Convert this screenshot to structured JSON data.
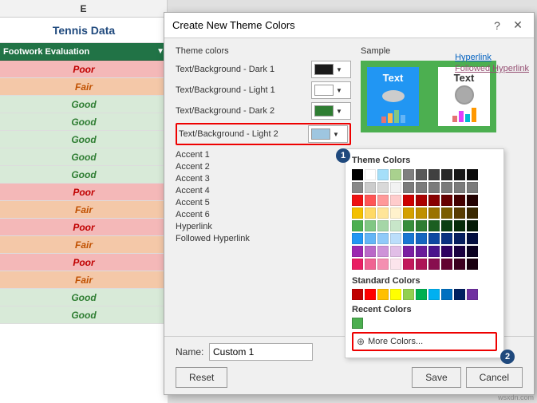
{
  "spreadsheet": {
    "col_header": "E",
    "title": "Tennis Data",
    "column_label": "Footwork Evaluation",
    "cells": [
      {
        "value": "Poor",
        "class": "cell-poor"
      },
      {
        "value": "Fair",
        "class": "cell-fair"
      },
      {
        "value": "Good",
        "class": "cell-good"
      },
      {
        "value": "Good",
        "class": "cell-good"
      },
      {
        "value": "Good",
        "class": "cell-good"
      },
      {
        "value": "Good",
        "class": "cell-good"
      },
      {
        "value": "Good",
        "class": "cell-good"
      },
      {
        "value": "Poor",
        "class": "cell-poor"
      },
      {
        "value": "Fair",
        "class": "cell-fair"
      },
      {
        "value": "Poor",
        "class": "cell-poor"
      },
      {
        "value": "Fair",
        "class": "cell-fair"
      },
      {
        "value": "Poor",
        "class": "cell-poor"
      },
      {
        "value": "Fair",
        "class": "cell-fair"
      },
      {
        "value": "Good",
        "class": "cell-good"
      },
      {
        "value": "Good",
        "class": "cell-good"
      }
    ]
  },
  "dialog": {
    "title": "Create New Theme Colors",
    "help_btn": "?",
    "close_btn": "✕",
    "sections": {
      "theme_colors_label": "Theme colors",
      "sample_label": "Sample"
    },
    "theme_rows": [
      {
        "label": "Text/Background - Dark 1",
        "underline": "T",
        "color": "#1a1a1a",
        "id": "dark1"
      },
      {
        "label": "Text/Background - Light 1",
        "underline": "e",
        "color": "#ffffff",
        "id": "light1"
      },
      {
        "label": "Text/Background - Dark 2",
        "underline": "e",
        "color": "#2e7d32",
        "id": "dark2"
      },
      {
        "label": "Text/Background - Light 2",
        "underline": "e",
        "color": "#9ec6e0",
        "id": "light2",
        "highlighted": true
      }
    ],
    "accent_links": [
      {
        "label": "Accent 1",
        "underline": "A"
      },
      {
        "label": "Accent 2",
        "underline": "A"
      },
      {
        "label": "Accent 3",
        "underline": "A"
      },
      {
        "label": "Accent 4",
        "underline": "A"
      },
      {
        "label": "Accent 5",
        "underline": "A"
      },
      {
        "label": "Accent 6",
        "underline": "A"
      },
      {
        "label": "Hyperlink",
        "underline": "H"
      },
      {
        "label": "Followed Hyperlink",
        "underline": "F"
      }
    ],
    "bubble1": "1",
    "bubble2": "2",
    "color_picker": {
      "theme_colors_title": "Theme Colors",
      "standard_colors_title": "Standard Colors",
      "recent_colors_title": "Recent Colors",
      "more_colors_text": "More Colors...",
      "theme_color_rows": [
        [
          "#000000",
          "#ffffff",
          "#a5dff9",
          "#a9d18e",
          "#7f7f7f",
          "#595959",
          "#404040",
          "#282828",
          "#171717",
          "#0a0a0a"
        ],
        [
          "#888888",
          "#cccccc",
          "#d9d9d9",
          "#f2f2f2",
          "#7b7b7b",
          "#7b7b7b",
          "#7b7b7b",
          "#7b7b7b",
          "#7b7b7b",
          "#7b7b7b"
        ],
        [
          "#ee1111",
          "#ff5555",
          "#ff9999",
          "#ffcccc",
          "#cc0000",
          "#aa0000",
          "#880000",
          "#660000",
          "#440000",
          "#220000"
        ],
        [
          "#f4c000",
          "#ffd966",
          "#ffe599",
          "#fff2cc",
          "#d4a000",
          "#bf9000",
          "#9a7200",
          "#7a5c00",
          "#593c00",
          "#3a2800"
        ],
        [
          "#4caf50",
          "#81c784",
          "#a5d6a7",
          "#c8e6c9",
          "#388e3c",
          "#2e7d32",
          "#1b5e20",
          "#0a3d12",
          "#062a0a",
          "#041a06"
        ],
        [
          "#2196f3",
          "#64b5f6",
          "#90caf9",
          "#bbdefb",
          "#1976d2",
          "#1565c0",
          "#0d47a1",
          "#093080",
          "#061e60",
          "#030e40"
        ],
        [
          "#9c27b0",
          "#ba68c8",
          "#ce93d8",
          "#e1bee7",
          "#7b1fa2",
          "#6a1b9a",
          "#4a148c",
          "#2e0060",
          "#1a0040",
          "#0a0020"
        ],
        [
          "#e91e63",
          "#f06292",
          "#f48fb1",
          "#fce4ec",
          "#c2185b",
          "#ad1457",
          "#880e4f",
          "#620331",
          "#3d0020",
          "#1a0010"
        ]
      ],
      "standard_color_row": [
        "#c00000",
        "#ff0000",
        "#ffc000",
        "#ffff00",
        "#92d050",
        "#00b050",
        "#00b0f0",
        "#0070c0",
        "#002060",
        "#7030a0"
      ],
      "recent_color": "#4caf50"
    },
    "name_label": "Name:",
    "name_value": "Custom 1",
    "buttons": {
      "reset": "Reset",
      "save": "Save",
      "cancel": "Cancel"
    }
  },
  "sample": {
    "text_label": "Text",
    "hyperlink_label": "Hyperlink",
    "followed_hyperlink_label": "Followed Hyperlink"
  },
  "watermark": "wsxdn.com"
}
